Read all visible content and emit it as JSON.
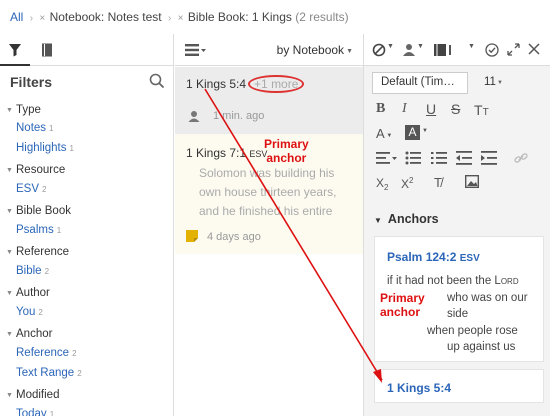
{
  "breadcrumb": {
    "all": "All",
    "crumb1": "Notebook: Notes test",
    "crumb2": "Bible Book: 1 Kings",
    "count": "(2 results)"
  },
  "filters": {
    "title": "Filters",
    "groups": [
      {
        "label": "Type",
        "items": [
          {
            "label": "Notes",
            "count": "1"
          },
          {
            "label": "Highlights",
            "count": "1"
          }
        ]
      },
      {
        "label": "Resource",
        "items": [
          {
            "label": "ESV",
            "count": "2"
          }
        ]
      },
      {
        "label": "Bible Book",
        "items": [
          {
            "label": "Psalms",
            "count": "1"
          }
        ]
      },
      {
        "label": "Reference",
        "items": [
          {
            "label": "Bible",
            "count": "2"
          }
        ]
      },
      {
        "label": "Author",
        "items": [
          {
            "label": "You",
            "count": "2"
          }
        ]
      },
      {
        "label": "Anchor",
        "items": [
          {
            "label": "Reference",
            "count": "2"
          },
          {
            "label": "Text Range",
            "count": "2"
          }
        ]
      },
      {
        "label": "Modified",
        "items": [
          {
            "label": "Today",
            "count": "1"
          }
        ]
      }
    ]
  },
  "results": {
    "sort_label": "by Notebook",
    "items": [
      {
        "ref": "1 Kings 5:4",
        "more": "+1 more",
        "time": "1 min. ago"
      },
      {
        "ref": "1 Kings 7:1",
        "version": "ESV",
        "snippet": "Solomon was building his own house thirteen years, and he finished his entire",
        "time": "4 days ago"
      }
    ]
  },
  "editor": {
    "font": "Default (Tim…",
    "size": "11",
    "anchors_title": "Anchors",
    "anchor1": {
      "ref": "Psalm 124:2",
      "version": "ESV",
      "line1": "if it had not been the",
      "lord": "Lord",
      "line2": "who was on our",
      "line3": "side",
      "line4": "when people rose",
      "line5": "up against us"
    },
    "anchor2": {
      "ref": "1 Kings 5:4"
    }
  },
  "annotations": {
    "label1_line1": "Primary",
    "label1_line2": "anchor",
    "label2_line1": "Primary",
    "label2_line2": "anchor"
  },
  "colors": {
    "link": "#2b66b8",
    "annotation": "#dd1111",
    "selected_row": "#ececec",
    "note_row": "#fdfbf0"
  }
}
